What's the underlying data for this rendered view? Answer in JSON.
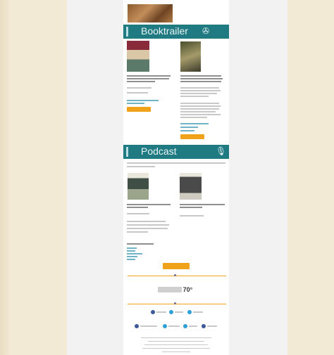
{
  "sections": {
    "booktrailer": {
      "title": "Booktrailer"
    },
    "podcast": {
      "title": "Podcast"
    }
  },
  "logo": {
    "text": "70°"
  },
  "colors": {
    "band": "#1f7a82",
    "button": "#f0a21a",
    "page_bg": "#f3ead6"
  },
  "icons": {
    "booktrailer": "film-reel-icon",
    "podcast": "microphone-icon"
  }
}
